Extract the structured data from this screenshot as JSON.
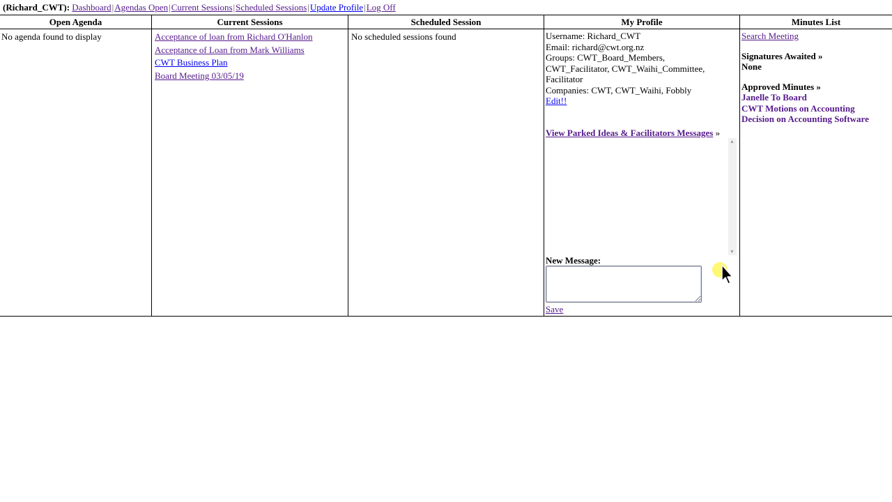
{
  "nav": {
    "user": "(Richard_CWT):",
    "links": [
      "Dashboard",
      "Agendas Open",
      "Current Sessions",
      "Scheduled Sessions",
      "Update Profile",
      "Log Off"
    ],
    "separator": "|"
  },
  "open_agenda": {
    "header": "Open Agenda",
    "empty_text": "No agenda found to display"
  },
  "current_sessions": {
    "header": "Current Sessions",
    "items": [
      "Acceptance of loan from Richard O'Hanlon",
      "Acceptance of Loan from Mark Williams",
      "CWT Business Plan",
      "Board Meeting 03/05/19"
    ]
  },
  "scheduled_session": {
    "header": "Scheduled Session",
    "empty_text": "No scheduled sessions found"
  },
  "profile": {
    "header": "My Profile",
    "username": "Username: Richard_CWT",
    "email": "Email: richard@cwt.org.nz",
    "groups": "Groups: CWT_Board_Members, CWT_Facilitator, CWT_Waihi_Committee, Facilitator",
    "companies": "Companies: CWT, CWT_Waihi, Fobbly",
    "edit_label": "Edit!!",
    "parked_link": "View Parked Ideas & Facilitators Messages",
    "parked_suffix": "»",
    "new_message_label": "New Message:",
    "new_message_value": "",
    "save_label": "Save"
  },
  "minutes": {
    "header": "Minutes List",
    "search_link": "Search Meeting",
    "signatures_title": "Signatures Awaited »",
    "signatures_value": "None",
    "approved_title": "Approved Minutes »",
    "approved_items": [
      "Janelle To Board",
      "CWT Motions on Accounting",
      "Decision on Accounting Software"
    ]
  },
  "colors": {
    "visited_link": "#551a8b",
    "unvisited_link": "#0000ee",
    "cursor_highlight": "#fff200"
  }
}
